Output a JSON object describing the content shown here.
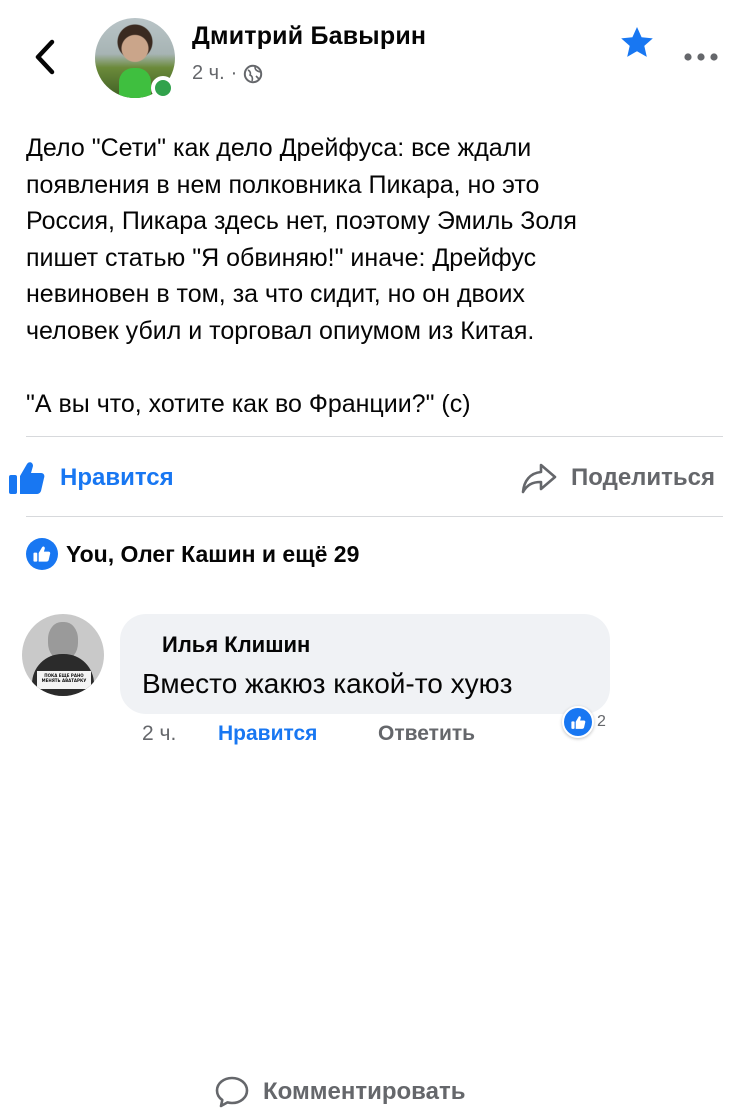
{
  "post": {
    "author": "Дмитрий Бавырин",
    "time": "2 ч.",
    "separator": "·",
    "text_lines": [
      "Дело \"Сети\" как дело Дрейфуса: все ждали",
      "появления в нем полковника Пикара, но это",
      "Россия, Пикара здесь нет, поэтому Эмиль Золя",
      "пишет статью \"Я обвиняю!\" иначе: Дрейфус",
      "невиновен в том, за что сидит, но он двоих",
      "человек убил и торговал опиумом из Китая."
    ],
    "quote": "\"А вы что, хотите как во Франции?\" (с)"
  },
  "actions": {
    "like": "Нравится",
    "comment": "Комментировать",
    "share": "Поделиться"
  },
  "reactions": {
    "summary": "You, Олег Кашин и ещё 29"
  },
  "comment": {
    "author": "Илья Клишин",
    "text": "Вместо жакюз какой-то хуюз",
    "time": "2 ч.",
    "like_label": "Нравится",
    "reply_label": "Ответить",
    "like_count": "2",
    "avatar_sign": "ПОКА ЕЩЕ РАНО МЕНЯТЬ АВАТАРКУ"
  },
  "icons": {
    "back": "chevron-left-icon",
    "favorite": "star-icon",
    "more": "more-dots-icon",
    "privacy": "globe-icon",
    "like": "thumbs-up-icon",
    "comment": "comment-bubble-icon",
    "share": "share-arrow-icon"
  },
  "colors": {
    "accent": "#1877f2",
    "secondary_text": "#65676b",
    "online": "#31a24c",
    "bubble": "#f0f2f5"
  }
}
